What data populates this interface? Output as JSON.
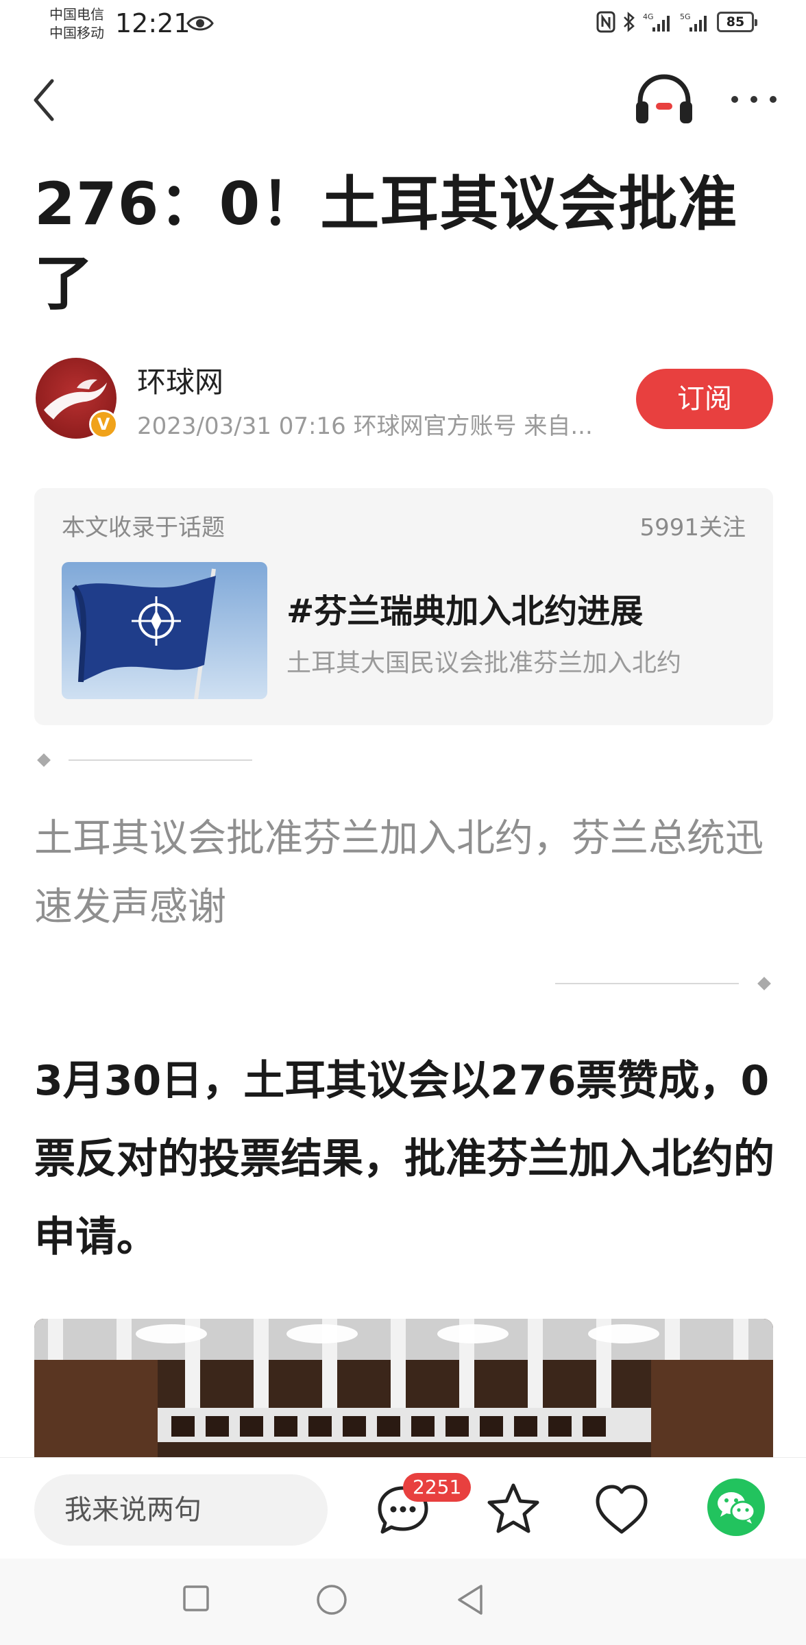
{
  "status_bar": {
    "carrier_1": "中国电信",
    "carrier_2": "中国移动",
    "time": "12:21",
    "network_1": "4G",
    "network_2": "5G",
    "battery": "85"
  },
  "nav": {
    "icons": [
      "back-icon",
      "headphones-icon",
      "more-icon"
    ]
  },
  "article": {
    "title": "276：0！土耳其议会批准了",
    "author": {
      "name": "环球网",
      "meta": "2023/03/31 07:16 环球网官方账号 来自...",
      "verified_badge": "V",
      "subscribe_label": "订阅"
    },
    "topic": {
      "label": "本文收录于话题",
      "followers": "5991关注",
      "name": "#芬兰瑞典加入北约进展",
      "description": "土耳其大国民议会批准芬兰加入北约"
    },
    "summary": "土耳其议会批准芬兰加入北约，芬兰总统迅速发声感谢",
    "lead": "3月30日，土耳其议会以276票赞成，0票反对的投票结果，批准芬兰加入北约的申请。"
  },
  "action_bar": {
    "comment_placeholder": "我来说两句",
    "comment_count": "2251",
    "icons": [
      "comment-icon",
      "star-icon",
      "heart-icon",
      "wechat-icon"
    ]
  },
  "colors": {
    "accent": "#e8403f",
    "wechat": "#22c35e",
    "badge": "#f0a21a",
    "muted_text": "#8f8f8f"
  }
}
